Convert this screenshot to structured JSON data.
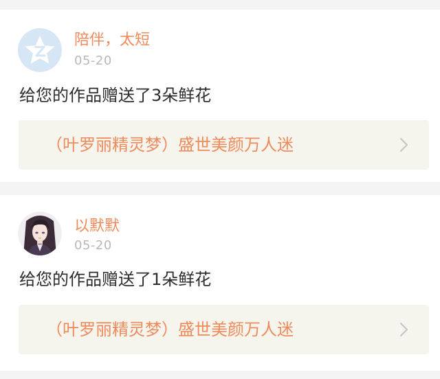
{
  "feed": {
    "items": [
      {
        "avatar_icon": "qzone-default-avatar-icon",
        "username": "陪伴，太短",
        "date": "05-20",
        "message": "给您的作品赠送了3朵鲜花",
        "work_title": "（叶罗丽精灵梦）盛世美颜万人迷",
        "link_icon": "chevron-right-icon"
      },
      {
        "avatar_icon": "anime-character-avatar",
        "username": "以默默",
        "date": "05-20",
        "message": "给您的作品赠送了1朵鲜花",
        "work_title": "（叶罗丽精灵梦）盛世美颜万人迷",
        "link_icon": "chevron-right-icon"
      }
    ]
  },
  "colors": {
    "accent": "#f08a5a",
    "page_background": "#f4f4f4",
    "card_background": "#ffffff",
    "link_background": "#f5f4ed",
    "date_text": "#b8b8b8",
    "body_text": "#2c2c2c",
    "chevron": "#c6c6c6"
  }
}
